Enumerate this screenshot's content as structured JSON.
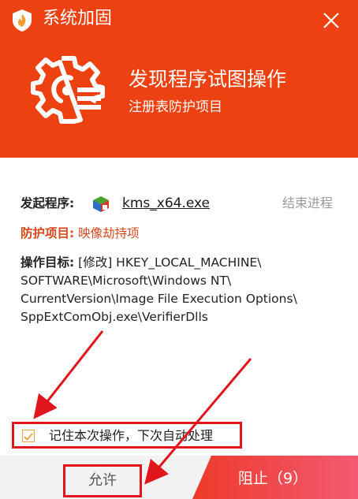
{
  "window": {
    "title": "系统加固"
  },
  "alert": {
    "heading": "发现程序试图操作",
    "subheading": "注册表防护项目"
  },
  "details": {
    "launcher_label": "发起程序:",
    "launcher_value": "kms_x64.exe",
    "end_process": "结束进程",
    "protect_label": "防护项目:",
    "protect_value": "映像劫持项",
    "target_label": "操作目标:",
    "target_lines": [
      "[修改] HKEY_LOCAL_MACHINE\\",
      "SOFTWARE\\Microsoft\\Windows NT\\",
      "CurrentVersion\\Image File Execution Options\\",
      "SppExtComObj.exe\\VerifierDlls"
    ]
  },
  "remember": {
    "label": "记住本次操作，下次自动处理",
    "checked": true
  },
  "buttons": {
    "allow": "允许",
    "block": "阻止（9）"
  },
  "colors": {
    "header": "#ee4111",
    "block_gradient_start": "#ee3a2a",
    "block_gradient_end": "#f35a72",
    "highlight": "#e0161c",
    "protect_text": "#d8481b"
  }
}
